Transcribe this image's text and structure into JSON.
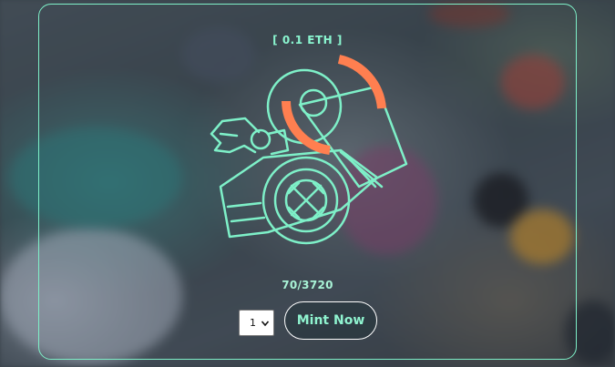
{
  "mint": {
    "price_label": "[ 0.1 ETH ]",
    "supply_label": "70/3720",
    "quantity_selected": "1",
    "button_label": "Mint Now"
  },
  "art": {
    "icon": "cannon-icon",
    "accent_color": "#ff7f50",
    "line_color": "#7ef0c8"
  }
}
